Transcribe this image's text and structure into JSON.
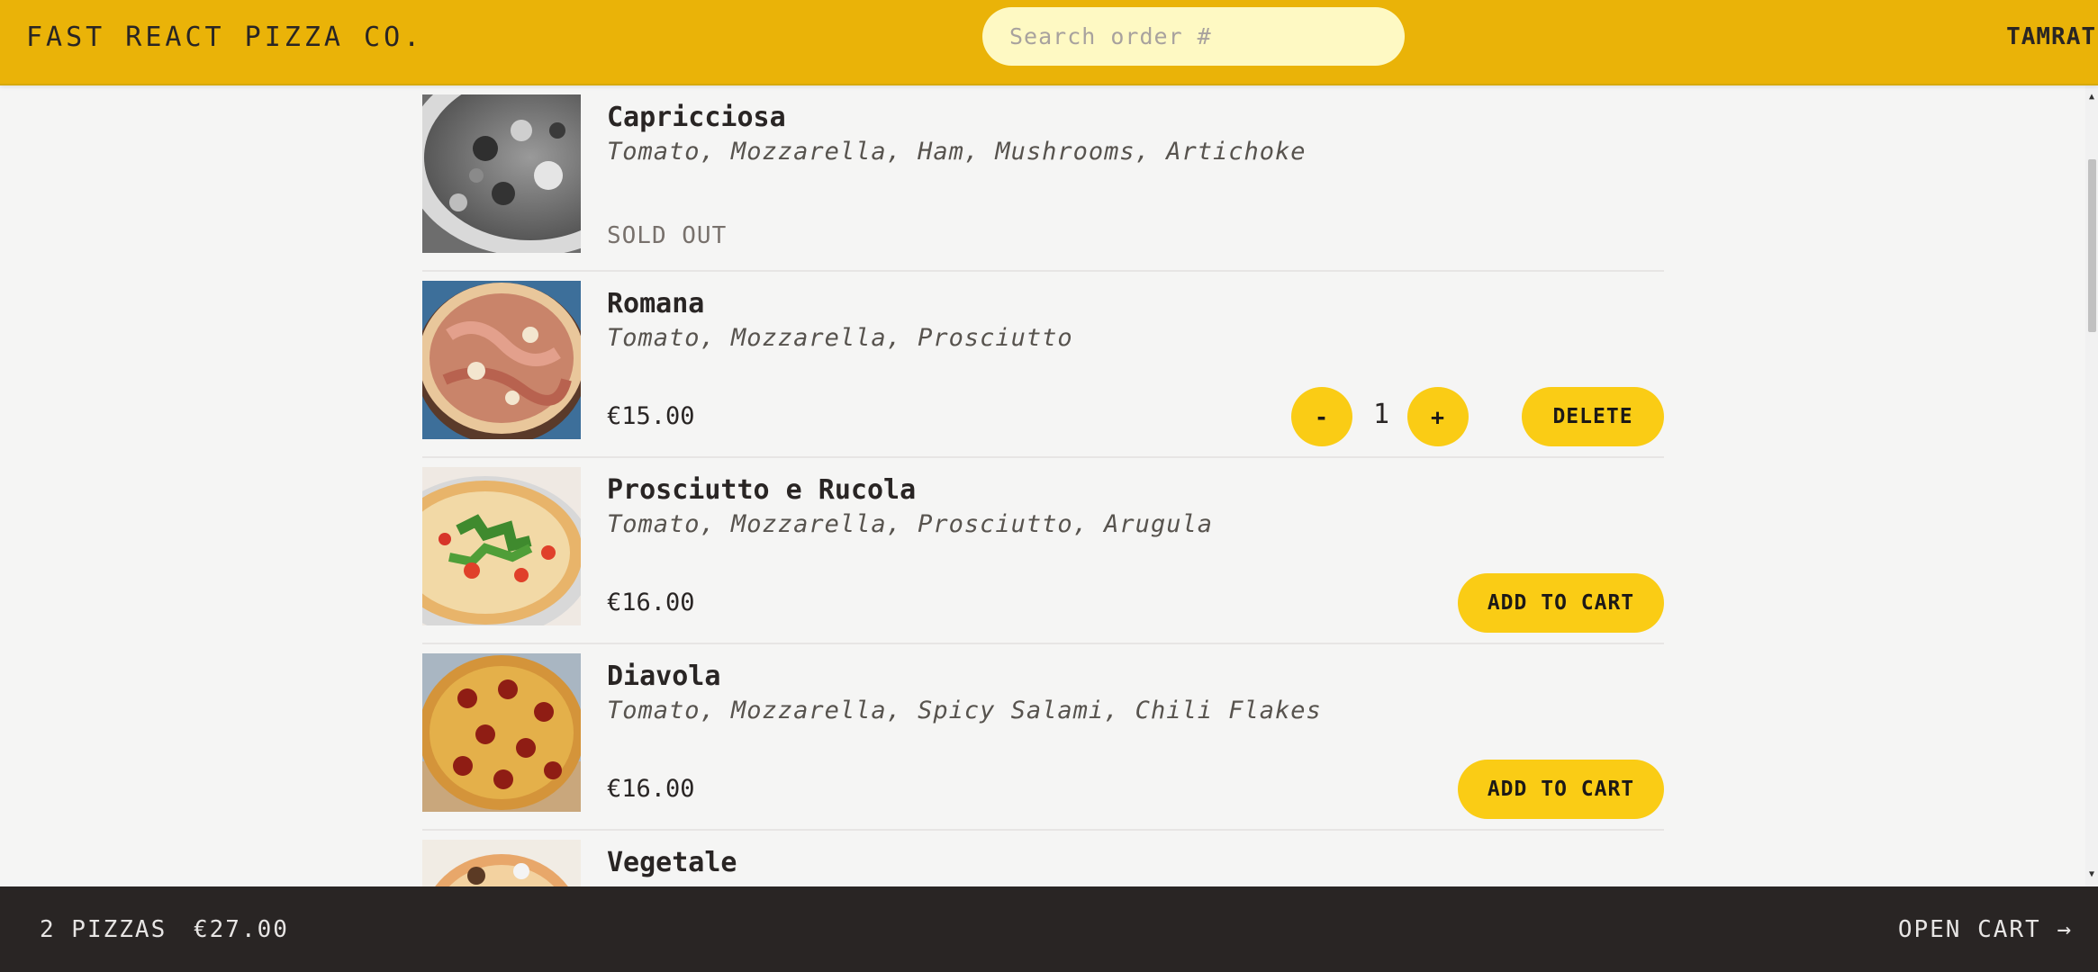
{
  "header": {
    "logo": "FAST REACT PIZZA CO.",
    "search_placeholder": "Search order #",
    "username": "TAMRAT"
  },
  "colors": {
    "brand_yellow": "#eab308",
    "button_yellow": "#facc15",
    "search_bg": "#fef9c3",
    "footer_bg": "#292524",
    "page_bg": "#f5f5f4"
  },
  "menu": {
    "items": [
      {
        "name": "Capricciosa",
        "ingredients": "Tomato, Mozzarella, Ham, Mushrooms, Artichoke",
        "status": "SOLD OUT"
      },
      {
        "name": "Romana",
        "ingredients": "Tomato, Mozzarella, Prosciutto",
        "price": "€15.00",
        "decrease_label": "-",
        "quantity": "1",
        "increase_label": "+",
        "delete_label": "DELETE"
      },
      {
        "name": "Prosciutto e Rucola",
        "ingredients": "Tomato, Mozzarella, Prosciutto, Arugula",
        "price": "€16.00",
        "add_label": "ADD TO CART"
      },
      {
        "name": "Diavola",
        "ingredients": "Tomato, Mozzarella, Spicy Salami, Chili Flakes",
        "price": "€16.00",
        "add_label": "ADD TO CART"
      },
      {
        "name": "Vegetale"
      }
    ]
  },
  "cart_overview": {
    "count": "2 PIZZAS",
    "total": "€27.00",
    "open_label": "OPEN CART →"
  },
  "scrollbar": {
    "up_icon": "▲",
    "down_icon": "▼"
  }
}
